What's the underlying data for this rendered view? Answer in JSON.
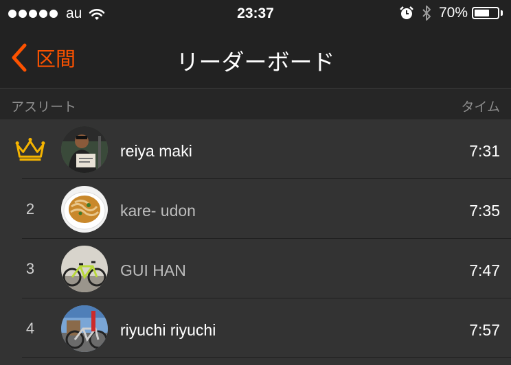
{
  "status_bar": {
    "carrier": "au",
    "time": "23:37",
    "battery_percent": "70%",
    "battery_level": 0.7,
    "signal_dots": 5,
    "icons": [
      "wifi-icon",
      "alarm-icon",
      "bluetooth-icon",
      "battery-icon"
    ]
  },
  "nav": {
    "back_label": "区間",
    "title": "リーダーボード",
    "accent_color": "#fc5200"
  },
  "columns": {
    "athlete": "アスリート",
    "time": "タイム"
  },
  "rows": [
    {
      "rank": "",
      "rank_icon": "crown-icon",
      "name": "reiya maki",
      "time": "7:31",
      "avatar": "rider-photo"
    },
    {
      "rank": "2",
      "name": "kare- udon",
      "time": "7:35",
      "avatar": "curry-udon-photo"
    },
    {
      "rank": "3",
      "name": "GUI HAN",
      "time": "7:47",
      "avatar": "bicycle-photo"
    },
    {
      "rank": "4",
      "name": "riyuchi riyuchi",
      "time": "7:57",
      "avatar": "bike-outdoor-photo"
    }
  ]
}
